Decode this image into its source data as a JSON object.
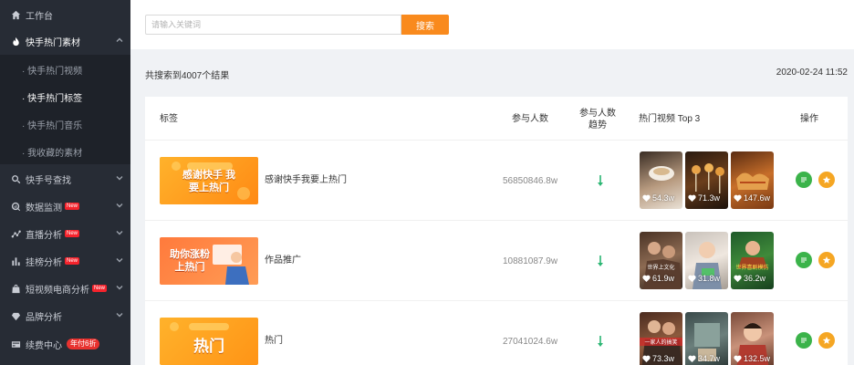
{
  "sidebar": {
    "workbench": "工作台",
    "hot_material": "快手热门素材",
    "sub_items": [
      "· 快手热门视频",
      "· 快手热门标签",
      "· 快手热门音乐",
      "· 我收藏的素材"
    ],
    "account_search": "快手号查找",
    "data_monitor": "数据监测",
    "live_analysis": "直播分析",
    "rank_analysis": "挂榜分析",
    "ecommerce_analysis": "短视频电商分析",
    "brand_analysis": "品牌分析",
    "renewal_center": "续费中心",
    "new_badge": "New",
    "promo_badge": "年付6折"
  },
  "search": {
    "placeholder": "请输入关键词",
    "button": "搜索"
  },
  "summary": {
    "result_count": "共搜索到4007个结果",
    "timestamp": "2020-02-24 11:52"
  },
  "table": {
    "headers": {
      "tag": "标签",
      "participants": "参与人数",
      "trend": "参与人数\n趋势",
      "top_videos": "热门视频 Top 3",
      "actions": "操作"
    },
    "rows": [
      {
        "banner_text": "感谢快手 我要上热门",
        "tag": "感谢快手我要上热门",
        "participants": "56850846.8w",
        "videos": [
          {
            "likes": "54.3w"
          },
          {
            "likes": "71.3w"
          },
          {
            "likes": "147.6w"
          }
        ]
      },
      {
        "banner_text": "助你涨粉 上热门",
        "tag": "作品推广",
        "participants": "10881087.9w",
        "videos": [
          {
            "likes": "61.9w",
            "caption": "世界上文化"
          },
          {
            "likes": "31.8w"
          },
          {
            "likes": "36.2w",
            "caption": "世界喜剧模仿"
          }
        ]
      },
      {
        "banner_text": "热门",
        "tag": "热门",
        "participants": "27041024.6w",
        "videos": [
          {
            "likes": "73.3w",
            "caption": "一家人的搞笑"
          },
          {
            "likes": "34.7w"
          },
          {
            "likes": "132.5w"
          }
        ]
      }
    ]
  },
  "colors": {
    "accent": "#f98a1d",
    "sidebar_bg": "#272c35",
    "trend_down": "#2bb673",
    "action_green": "#3bb34a",
    "action_orange": "#f5a623"
  }
}
